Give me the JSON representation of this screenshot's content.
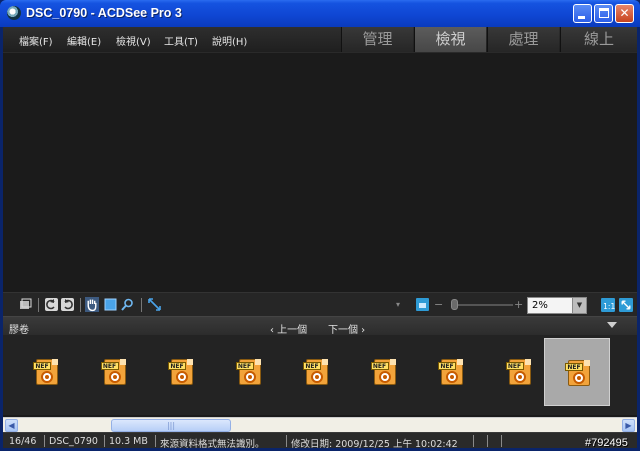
{
  "window": {
    "title": "DSC_0790 - ACDSee Pro 3",
    "controls": [
      "minimize",
      "maximize",
      "close"
    ]
  },
  "menu": {
    "items": [
      "檔案(F)",
      "編輯(E)",
      "檢視(V)",
      "工具(T)",
      "說明(H)"
    ]
  },
  "modes": {
    "tabs": [
      "管理",
      "檢視",
      "處理",
      "線上"
    ],
    "active": "檢視"
  },
  "toolbar": {
    "zoom_minus": "−",
    "zoom_plus": "+",
    "zoom_value": "2%",
    "zoom_dropdown": "▼",
    "more_arrow": "▾",
    "icons": [
      "filmstrip-view-icon",
      "rotate-left-icon",
      "rotate-right-icon",
      "hand-tool-icon",
      "select-tool-icon",
      "zoom-tool-icon",
      "fit-icon",
      "zoom-lock-icon",
      "actual-size-icon",
      "fit-window-icon"
    ]
  },
  "filmstrip": {
    "title": "膠卷",
    "prev": "‹ 上一個",
    "next": "下一個 ›",
    "menu_icon": "triangle-down-icon",
    "thumbnails": [
      {
        "type": "NEF",
        "selected": false
      },
      {
        "type": "NEF",
        "selected": false
      },
      {
        "type": "NEF",
        "selected": false
      },
      {
        "type": "NEF",
        "selected": false
      },
      {
        "type": "NEF",
        "selected": false
      },
      {
        "type": "NEF",
        "selected": false
      },
      {
        "type": "NEF",
        "selected": false
      },
      {
        "type": "NEF",
        "selected": false
      },
      {
        "type": "NEF",
        "selected": true
      }
    ]
  },
  "scrollbar": {
    "left_arrow": "◀",
    "right_arrow": "▶",
    "grip": "|||"
  },
  "status": {
    "position": "16/46",
    "filename": "DSC_0790",
    "size": "10.3 MB",
    "message": "來源資料格式無法識別。",
    "modified": "修改日期: 2009/12/25 上午 10:02:42"
  },
  "watermark": "#792495",
  "colors": {
    "titlebar": "#0f47d4",
    "background": "#1a1a1a",
    "selected_thumb": "#a9a9a9",
    "accent_icon": "#2e9bd6"
  }
}
